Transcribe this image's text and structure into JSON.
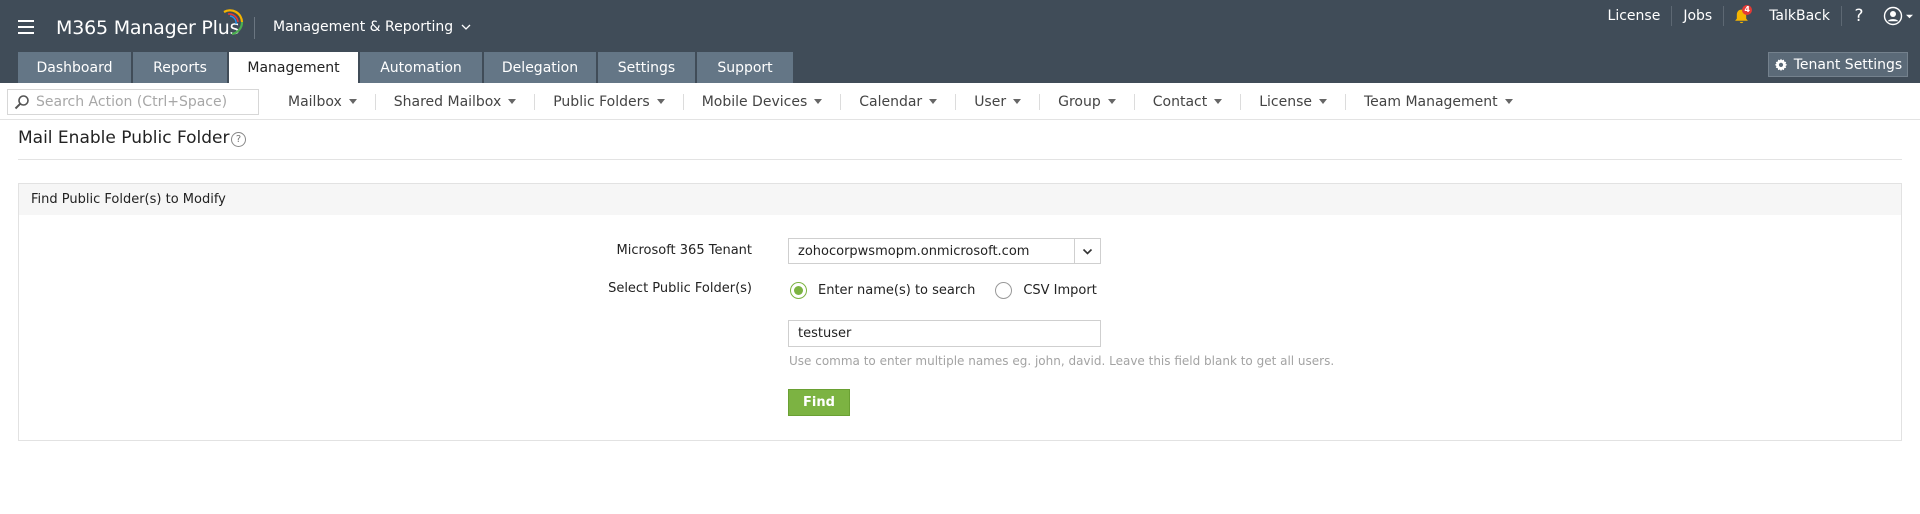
{
  "header": {
    "brand": "M365 Manager Plus",
    "section": "Management & Reporting",
    "links": [
      "License",
      "Jobs"
    ],
    "notification_count": "4",
    "talkback": "TalkBack",
    "help": "?"
  },
  "tabs": [
    {
      "label": "Dashboard",
      "active": false
    },
    {
      "label": "Reports",
      "active": false
    },
    {
      "label": "Management",
      "active": true
    },
    {
      "label": "Automation",
      "active": false
    },
    {
      "label": "Delegation",
      "active": false
    },
    {
      "label": "Settings",
      "active": false
    },
    {
      "label": "Support",
      "active": false
    }
  ],
  "tenant_settings": "Tenant Settings",
  "search": {
    "placeholder": "Search Action (Ctrl+Space)",
    "value": ""
  },
  "action_menu": [
    "Mailbox",
    "Shared Mailbox",
    "Public Folders",
    "Mobile Devices",
    "Calendar",
    "User",
    "Group",
    "Contact",
    "License",
    "Team Management"
  ],
  "page": {
    "title": "Mail Enable Public Folder",
    "help": "?"
  },
  "panel": {
    "title": "Find Public Folder(s) to Modify",
    "tenant_label": "Microsoft 365 Tenant",
    "tenant_value": "zohocorpwsmopm.onmicrosoft.com",
    "select_label": "Select Public Folder(s)",
    "option_search": "Enter name(s) to search",
    "option_csv": "CSV Import",
    "selected_option": "search",
    "names_value": "testuser",
    "hint": "Use comma to enter multiple names eg. john, david. Leave this field blank to get all users.",
    "find_label": "Find"
  },
  "colors": {
    "header_bg": "#404c58",
    "tab_bg": "#647686",
    "accent_green": "#7cb342",
    "notification_red": "#e53935"
  }
}
